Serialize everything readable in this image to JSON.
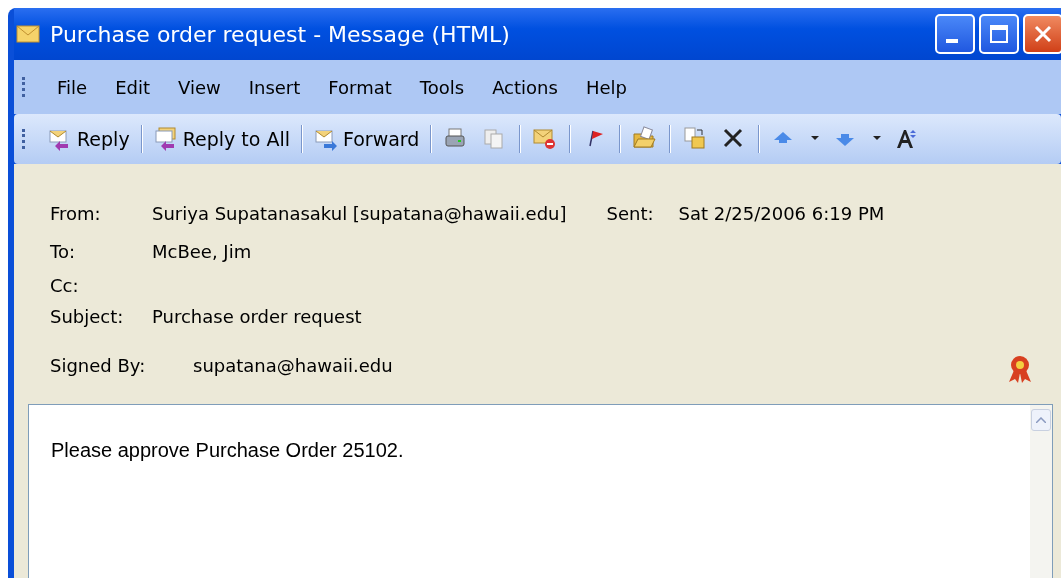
{
  "window": {
    "title": "Purchase order request - Message (HTML)"
  },
  "menu": [
    "File",
    "Edit",
    "View",
    "Insert",
    "Format",
    "Tools",
    "Actions",
    "Help"
  ],
  "toolbar": [
    {
      "label": "Reply"
    },
    {
      "label": "Reply to All"
    },
    {
      "label": "Forward"
    }
  ],
  "header": {
    "from_label": "From:",
    "from": "Suriya Supatanasakul [supatana@hawaii.edu]",
    "sent_label": "Sent:",
    "sent": "Sat 2/25/2006 6:19 PM",
    "to_label": "To:",
    "to": "McBee, Jim",
    "cc_label": "Cc:",
    "subject_label": "Subject:",
    "subject": "Purchase order request",
    "signed_label": "Signed By:",
    "signed": "supatana@hawaii.edu"
  },
  "body": "Please approve Purchase Order 25102."
}
